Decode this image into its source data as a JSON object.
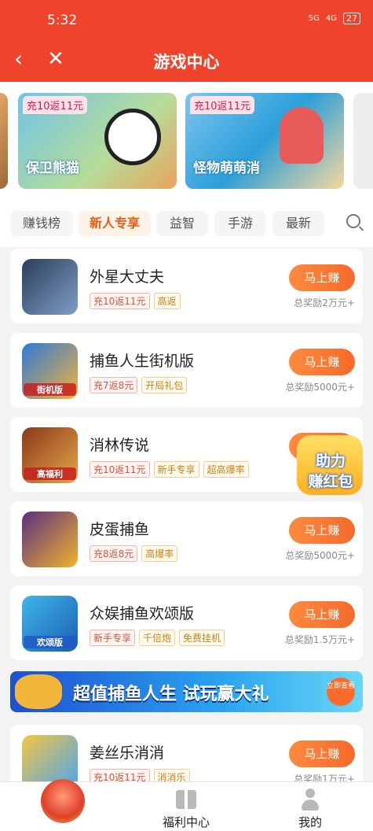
{
  "status_bar": {
    "time": "5:32",
    "signal1": "5G",
    "signal2": "4G",
    "battery": "27"
  },
  "nav": {
    "title": "游戏中心",
    "back_icon": "back-chevron-icon",
    "close_icon": "close-icon"
  },
  "banners": [
    {
      "tag": "充10返11元",
      "title": "保卫熊猫"
    },
    {
      "tag": "充10返11元",
      "title": "怪物萌萌消"
    }
  ],
  "tabs": [
    {
      "label": "赚钱榜",
      "active": false
    },
    {
      "label": "新人专享",
      "active": true
    },
    {
      "label": "益智",
      "active": false
    },
    {
      "label": "手游",
      "active": false
    },
    {
      "label": "最新",
      "active": false
    }
  ],
  "games": [
    {
      "name": "外星大丈夫",
      "tags": [
        "充10返11元",
        "高返"
      ],
      "button": "马上赚",
      "reward": "总奖励2万元+",
      "badge": ""
    },
    {
      "name": "捕鱼人生街机版",
      "tags": [
        "充7返8元",
        "开局礼包"
      ],
      "button": "马上赚",
      "reward": "总奖励5000元+",
      "badge": "街机版"
    },
    {
      "name": "消林传说",
      "tags": [
        "充10返11元",
        "新手专享",
        "超高爆率"
      ],
      "button": "马上赚",
      "reward": "",
      "badge": "高福利"
    },
    {
      "name": "皮蛋捕鱼",
      "tags": [
        "充8返8元",
        "高爆率"
      ],
      "button": "马上赚",
      "reward": "总奖励5000元+",
      "badge": ""
    },
    {
      "name": "众娱捕鱼欢颂版",
      "tags": [
        "新手专享",
        "千倍炮",
        "免费挂机"
      ],
      "button": "马上赚",
      "reward": "总奖励1.5万元+",
      "badge": "欢颂版"
    },
    {
      "name": "姜丝乐消消",
      "tags": [
        "充10返11元",
        "消消乐"
      ],
      "button": "马上赚",
      "reward": "总奖励1万元+",
      "badge": ""
    }
  ],
  "promo": {
    "text": "超值捕鱼人生 试玩赢大礼",
    "button": "立即查看"
  },
  "float_badge": {
    "line1": "助力",
    "line2": "赚红包"
  },
  "bottom_nav": [
    {
      "label": "",
      "icon": "mascot-icon"
    },
    {
      "label": "福利中心",
      "icon": "gift-icon"
    },
    {
      "label": "我的",
      "icon": "person-icon"
    }
  ],
  "colors": {
    "brand": "#f0432b",
    "accent": "#f46a2c",
    "tag_red": "#d5553b",
    "tag_gold": "#c98312"
  }
}
